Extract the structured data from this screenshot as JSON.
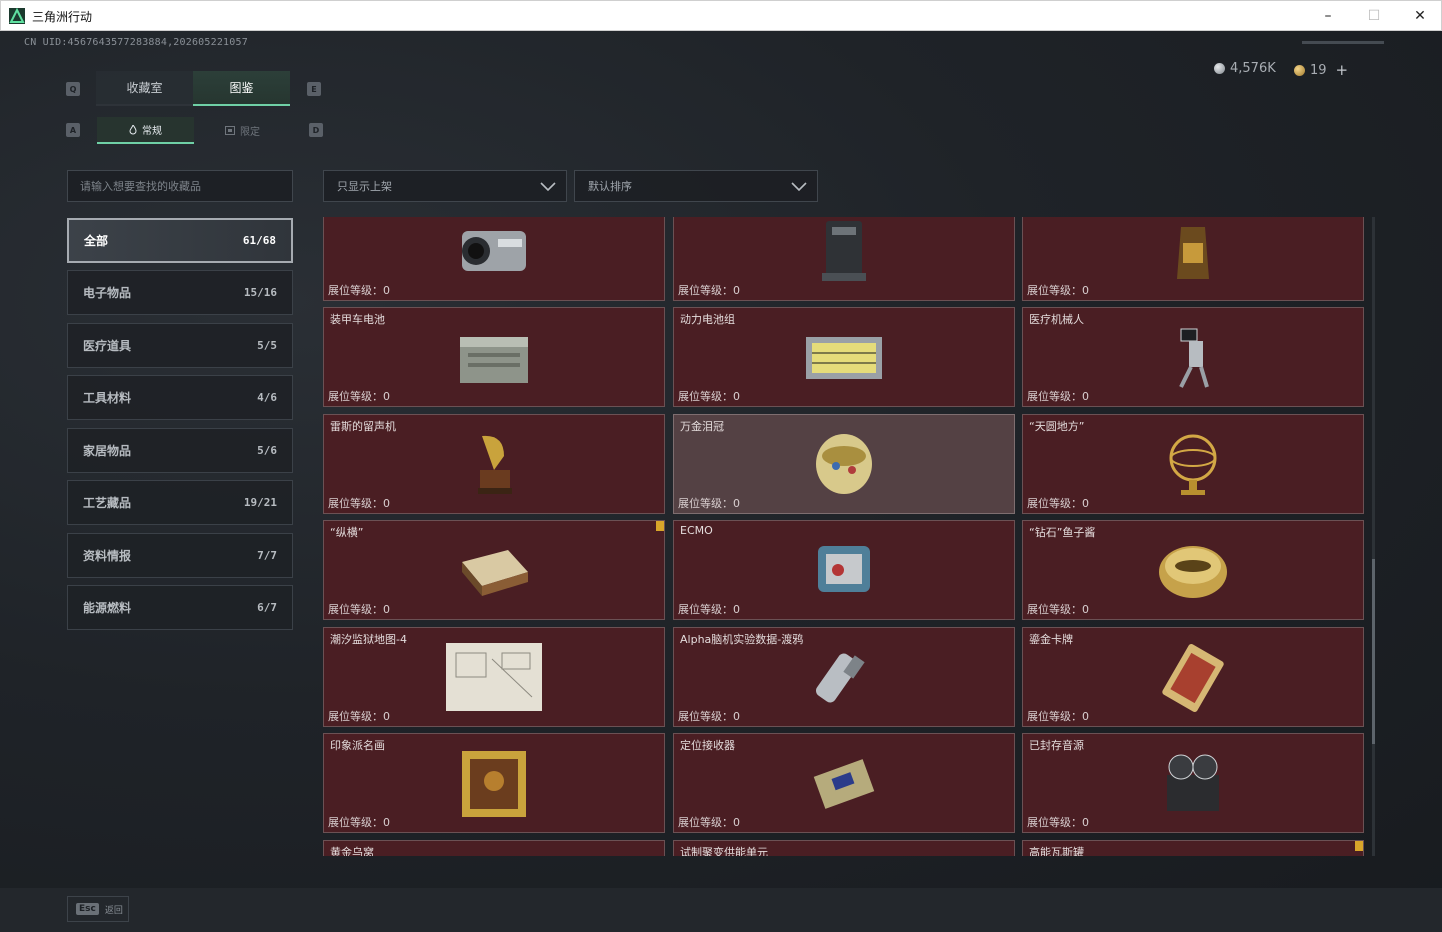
{
  "window": {
    "title": "三角洲行动",
    "minimize": "–",
    "maximize": "☐",
    "close": "✕"
  },
  "uid": "CN UID:4567643577283884,202605221057",
  "currency": {
    "silver": "4,576K",
    "gold": "19",
    "plus": "+"
  },
  "keys": {
    "q": "Q",
    "e": "E",
    "a": "A",
    "d": "D"
  },
  "tabs": [
    {
      "label": "收藏室",
      "active": false
    },
    {
      "label": "图鉴",
      "active": true
    }
  ],
  "subtabs": [
    {
      "label": "常规",
      "icon": "flame-icon",
      "active": true
    },
    {
      "label": "限定",
      "icon": "frame-icon",
      "active": false
    }
  ],
  "search": {
    "placeholder": "请输入想要查找的收藏品"
  },
  "filters": {
    "shelf": "只显示上架",
    "sort": "默认排序"
  },
  "categories": [
    {
      "label": "全部",
      "count": "61/68",
      "active": true
    },
    {
      "label": "电子物品",
      "count": "15/16"
    },
    {
      "label": "医疗道具",
      "count": "5/5"
    },
    {
      "label": "工具材料",
      "count": "4/6"
    },
    {
      "label": "家居物品",
      "count": "5/6"
    },
    {
      "label": "工艺藏品",
      "count": "19/21"
    },
    {
      "label": "资料情报",
      "count": "7/7"
    },
    {
      "label": "能源燃料",
      "count": "6/7"
    }
  ],
  "level_label": "展位等级：0",
  "items": [
    {
      "name": "",
      "icon": "camera-icon"
    },
    {
      "name": "",
      "icon": "coffee-machine-icon"
    },
    {
      "name": "",
      "icon": "coffee-bag-icon"
    },
    {
      "name": "装甲车电池",
      "icon": "car-battery-icon"
    },
    {
      "name": "动力电池组",
      "icon": "battery-pack-icon"
    },
    {
      "name": "医疗机械人",
      "icon": "medical-robot-icon"
    },
    {
      "name": "雷斯的留声机",
      "icon": "gramophone-icon"
    },
    {
      "name": "万金泪冠",
      "icon": "jeweled-egg-icon",
      "highlight": true
    },
    {
      "name": "“天圆地方”",
      "icon": "armillary-icon"
    },
    {
      "name": "“纵横”",
      "icon": "chessboard-icon",
      "badge": true
    },
    {
      "name": "ECMO",
      "icon": "ecmo-icon"
    },
    {
      "name": "“钻石”鱼子酱",
      "icon": "caviar-tin-icon"
    },
    {
      "name": "潮汐监狱地图-4",
      "icon": "map-icon"
    },
    {
      "name": "Alpha脑机实验数据-渡鸦",
      "icon": "data-canister-icon"
    },
    {
      "name": "鎏金卡牌",
      "icon": "gilded-card-icon"
    },
    {
      "name": "印象派名画",
      "icon": "painting-icon"
    },
    {
      "name": "定位接收器",
      "icon": "receiver-icon"
    },
    {
      "name": "已封存音源",
      "icon": "tape-recorder-icon"
    },
    {
      "name": "黄金乌窝",
      "icon": "gold-item-icon"
    },
    {
      "name": "试制聚变供能单元",
      "icon": "fusion-unit-icon"
    },
    {
      "name": "高能瓦斯罐",
      "icon": "gas-tank-icon",
      "badge": true
    }
  ],
  "bottom": {
    "esc_key": "Esc",
    "esc_label": "返回"
  },
  "colors": {
    "accent": "#6fd0a6",
    "card_bg": "#4a1e23",
    "card_highlight": "#544144",
    "badge": "#d9a62a"
  }
}
